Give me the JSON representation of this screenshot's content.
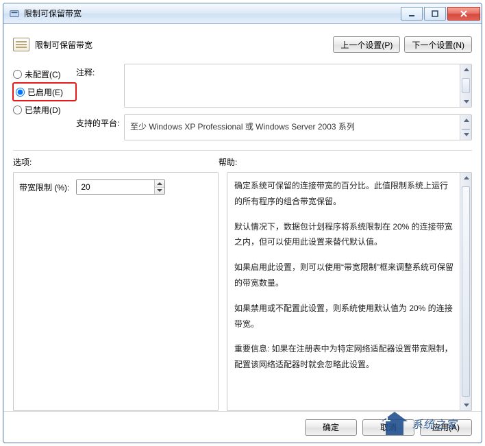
{
  "window": {
    "title": "限制可保留带宽"
  },
  "header": {
    "title": "限制可保留带宽",
    "prev_label": "上一个设置(P)",
    "next_label": "下一个设置(N)"
  },
  "state_radio": {
    "not_configured": "未配置(C)",
    "enabled": "已启用(E)",
    "disabled": "已禁用(D)",
    "selected": "enabled"
  },
  "labels": {
    "comment": "注释:",
    "platform": "支持的平台:",
    "options_heading": "选项:",
    "help_heading": "帮助:"
  },
  "comment_text": "",
  "platform_text": "至少 Windows XP Professional 或 Windows Server 2003 系列",
  "options": {
    "bandwidth_label": "带宽限制 (%):",
    "bandwidth_value": "20"
  },
  "help_paragraphs": [
    "确定系统可保留的连接带宽的百分比。此值限制系统上运行的所有程序的组合带宽保留。",
    "默认情况下，数据包计划程序将系统限制在 20% 的连接带宽之内，但可以使用此设置来替代默认值。",
    "如果启用此设置，则可以使用“带宽限制”框来调整系统可保留的带宽数量。",
    "如果禁用或不配置此设置，则系统使用默认值为 20% 的连接带宽。",
    "重要信息: 如果在注册表中为特定网络适配器设置带宽限制，配置该网络适配器时就会忽略此设置。"
  ],
  "footer": {
    "ok": "确定",
    "cancel": "取消",
    "apply": "应用(A)"
  },
  "watermark_text": "系统之家"
}
